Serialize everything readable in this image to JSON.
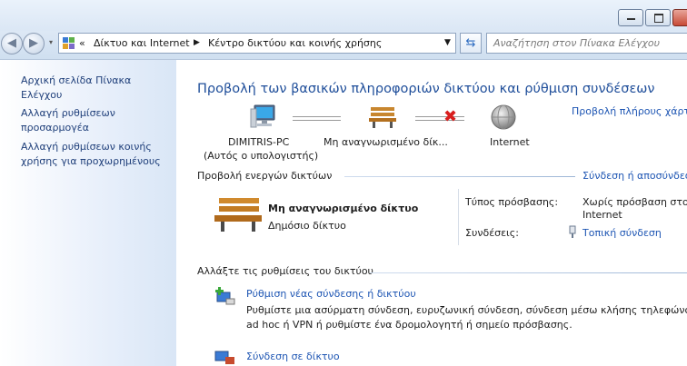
{
  "address_bar": {
    "prefix": "«",
    "crumbs": [
      "Δίκτυο και Internet",
      "Κέντρο δικτύου και κοινής χρήσης"
    ]
  },
  "search": {
    "placeholder": "Αναζήτηση στον Πίνακα Ελέγχου"
  },
  "sidebar": {
    "items": [
      {
        "label": "Αρχική σελίδα Πίνακα Ελέγχου"
      },
      {
        "label": "Αλλαγή ρυθμίσεων προσαρμογέα"
      },
      {
        "label": "Αλλαγή ρυθμίσεων κοινής χρήσης για προχωρημένους"
      }
    ]
  },
  "main": {
    "title": "Προβολή των βασικών πληροφοριών δικτύου και ρύθμιση συνδέσεων",
    "full_map_link": "Προβολή πλήρους χάρτη",
    "map": {
      "computer_name": "DIMITRIS-PC",
      "computer_sub": "(Αυτός ο υπολογιστής)",
      "network_name": "Μη αναγνωρισμένο δίκ...",
      "internet_label": "Internet"
    },
    "active_header": "Προβολή ενεργών δικτύων",
    "connect_link": "Σύνδεση ή αποσύνδεση",
    "active_network": {
      "name": "Μη αναγνωρισμένο δίκτυο",
      "type": "Δημόσιο δίκτυο",
      "access_label": "Τύπος πρόσβασης:",
      "access_value": "Χωρίς πρόσβαση στο Internet",
      "connections_label": "Συνδέσεις:",
      "connections_value": "Τοπική σύνδεση"
    },
    "change_header": "Αλλάξτε τις ρυθμίσεις του δικτύου",
    "tasks": [
      {
        "title": "Ρύθμιση νέας σύνδεσης ή δικτύου",
        "desc_line1": "Ρυθμίστε μια ασύρματη σύνδεση, ευρυζωνική σύνδεση,  σύνδεση μέσω κλήσης τηλεφώνου,",
        "desc_line2": "ad hoc ή VPN ή ρυθμίστε ένα δρομολογητή ή σημείο πρόσβασης."
      },
      {
        "title": "Σύνδεση σε δίκτυο"
      }
    ]
  },
  "colors": {
    "link": "#1d55b3",
    "title": "#1f4e9a",
    "sidebar_link": "#1f3f7a"
  }
}
